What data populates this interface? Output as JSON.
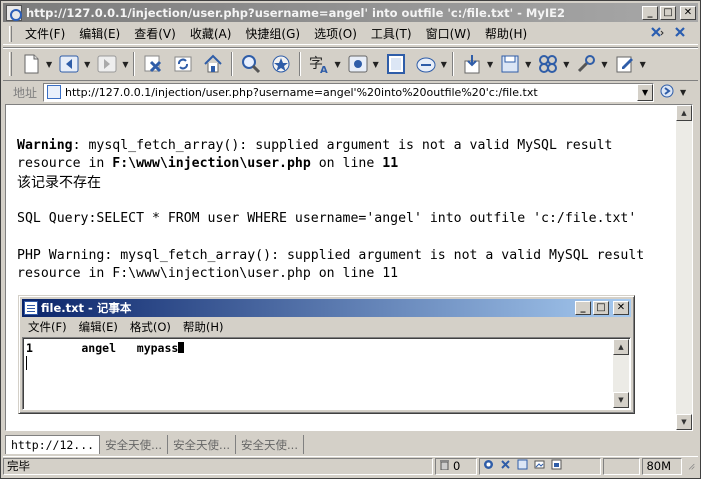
{
  "window": {
    "title": "http://127.0.0.1/injection/user.php?username=angel' into outfile 'c:/file.txt' - MyIE2",
    "minimize": "_",
    "maximize": "□",
    "close": "✕"
  },
  "menubar": {
    "items": [
      "文件(F)",
      "编辑(E)",
      "查看(V)",
      "收藏(A)",
      "快捷组(G)",
      "选项(O)",
      "工具(T)",
      "窗口(W)",
      "帮助(H)"
    ]
  },
  "toolbar": {
    "icons": [
      "new-page-icon",
      "back-icon",
      "forward-icon",
      "stop-icon",
      "refresh-icon",
      "home-icon",
      "search-icon",
      "favorites-icon",
      "font-icon",
      "view-icon",
      "fullscreen-icon",
      "history-icon",
      "download-icon",
      "save-icon",
      "groups-icon",
      "tools-icon",
      "edit-page-icon"
    ]
  },
  "addressbar": {
    "label": "地址",
    "url": "http://127.0.0.1/injection/user.php?username=angel'%20into%20outfile%20'c:/file.txt"
  },
  "page": {
    "warning_label": "Warning",
    "warning_msg": ": mysql_fetch_array(): supplied argument is not a valid MySQL result",
    "resource_in": "resource in ",
    "file_path": "F:\\www\\injection\\user.php",
    "on_line": " on line ",
    "line_no": "11",
    "not_exist": "该记录不存在",
    "sql_query": "SQL Query:SELECT * FROM user WHERE username='angel' into outfile 'c:/file.txt'",
    "php_warning_1": "PHP Warning: mysql_fetch_array(): supplied argument is not a valid MySQL result",
    "php_warning_2": "resource in F:\\www\\injection\\user.php on line 11"
  },
  "notepad": {
    "title": "file.txt - 记事本",
    "menu": [
      "文件(F)",
      "编辑(E)",
      "格式(O)",
      "帮助(H)"
    ],
    "content": "1       angel   mypass"
  },
  "tabs": [
    {
      "label": "http://12...",
      "active": true
    },
    {
      "label": "安全天使...",
      "active": false
    },
    {
      "label": "安全天使...",
      "active": false
    },
    {
      "label": "安全天使...",
      "active": false
    }
  ],
  "statusbar": {
    "status": "完毕",
    "count": "0",
    "memory": "80M"
  }
}
